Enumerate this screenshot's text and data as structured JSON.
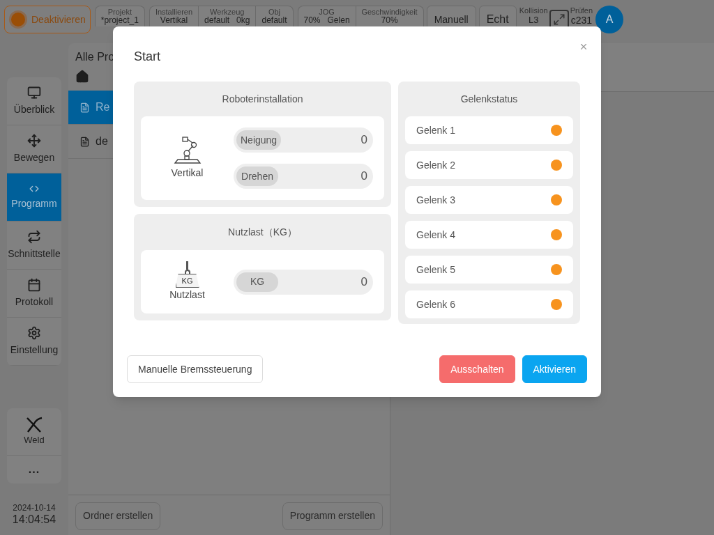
{
  "topbar": {
    "power_button": "Deaktivieren",
    "groups": [
      [
        {
          "label": "Projekt",
          "values": [
            "*project_1"
          ]
        }
      ],
      [
        {
          "label": "Installieren",
          "values": [
            "Vertikal"
          ]
        },
        {
          "label": "Werkzeug",
          "values": [
            "default",
            "0kg"
          ]
        },
        {
          "label": "Obj",
          "values": [
            "default"
          ]
        }
      ],
      [
        {
          "label": "JOG",
          "values": [
            "70%",
            "Gelen"
          ]
        },
        {
          "label": "Geschwindigkeit",
          "values": [
            "70%"
          ]
        }
      ]
    ],
    "mode_buttons": [
      "Manuell",
      "Echt"
    ],
    "collision": {
      "label": "Kollision",
      "value": "L3"
    },
    "check": {
      "label": "Prüfen",
      "value": "c231"
    },
    "avatar": "A"
  },
  "sidebar": {
    "items": [
      {
        "label": "Überblick",
        "selected": false
      },
      {
        "label": "Bewegen",
        "selected": false
      },
      {
        "label": "Programm",
        "selected": true
      },
      {
        "label": "Schnittstelle",
        "selected": false
      },
      {
        "label": "Protokoll",
        "selected": false
      },
      {
        "label": "Einstellung",
        "selected": false
      }
    ],
    "plugin": "Weld",
    "more": "...",
    "date": "2024-10-14",
    "time": "14:04:54"
  },
  "programs": {
    "title": "Alle Pro",
    "rows": [
      {
        "name": "Re",
        "selected": true
      },
      {
        "name": "de",
        "selected": false
      }
    ],
    "buttons": [
      "Ordner erstellen",
      "Programm erstellen"
    ]
  },
  "dialog": {
    "title": "Start",
    "installation": {
      "title": "Roboterinstallation",
      "mount": "Vertikal",
      "fields": [
        {
          "label": "Neigung",
          "value": "0"
        },
        {
          "label": "Drehen",
          "value": "0"
        }
      ]
    },
    "payload": {
      "title": "Nutzlast（KG）",
      "icon_label": "KG",
      "mount": "Nutzlast",
      "fields": [
        {
          "label": "KG",
          "value": "0"
        }
      ]
    },
    "joints": {
      "title": "Gelenkstatus",
      "items": [
        {
          "name": "Gelenk 1",
          "color": "#f7931e"
        },
        {
          "name": "Gelenk 2",
          "color": "#f7931e"
        },
        {
          "name": "Gelenk 3",
          "color": "#f7931e"
        },
        {
          "name": "Gelenk 4",
          "color": "#f7931e"
        },
        {
          "name": "Gelenk 5",
          "color": "#f7931e"
        },
        {
          "name": "Gelenk 6",
          "color": "#f7931e"
        }
      ]
    },
    "buttons": [
      {
        "kind": "outline",
        "label": "Manuelle Bremssteuerung"
      },
      {
        "kind": "danger",
        "label": "Ausschalten"
      },
      {
        "kind": "primary",
        "label": "Aktivieren"
      }
    ]
  }
}
